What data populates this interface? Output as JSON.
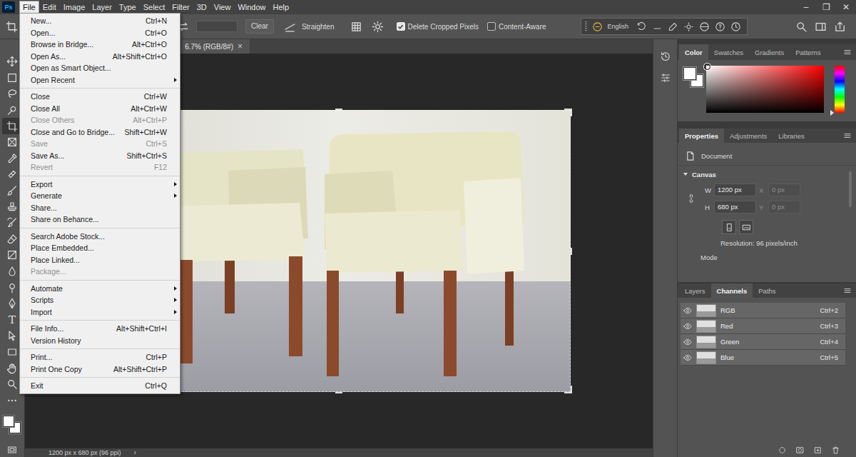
{
  "app": {
    "logo": "Ps",
    "window_controls": [
      "–",
      "❐",
      "✕"
    ]
  },
  "menubar": [
    {
      "label": "File",
      "selected": true
    },
    {
      "label": "Edit",
      "selected": false
    },
    {
      "label": "Image",
      "selected": false
    },
    {
      "label": "Layer",
      "selected": false
    },
    {
      "label": "Type",
      "selected": false
    },
    {
      "label": "Select",
      "selected": false
    },
    {
      "label": "Filter",
      "selected": false
    },
    {
      "label": "3D",
      "selected": false
    },
    {
      "label": "View",
      "selected": false
    },
    {
      "label": "Window",
      "selected": false
    },
    {
      "label": "Help",
      "selected": false
    }
  ],
  "file_menu": [
    [
      {
        "label": "New...",
        "shortcut": "Ctrl+N",
        "disabled": false,
        "submenu": false
      },
      {
        "label": "Open...",
        "shortcut": "Ctrl+O",
        "disabled": false,
        "submenu": false
      },
      {
        "label": "Browse in Bridge...",
        "shortcut": "Alt+Ctrl+O",
        "disabled": false,
        "submenu": false
      },
      {
        "label": "Open As...",
        "shortcut": "Alt+Shift+Ctrl+O",
        "disabled": false,
        "submenu": false
      },
      {
        "label": "Open as Smart Object...",
        "disabled": false,
        "submenu": false
      },
      {
        "label": "Open Recent",
        "disabled": false,
        "submenu": true
      }
    ],
    [
      {
        "label": "Close",
        "shortcut": "Ctrl+W",
        "disabled": false,
        "submenu": false
      },
      {
        "label": "Close All",
        "shortcut": "Alt+Ctrl+W",
        "disabled": false,
        "submenu": false
      },
      {
        "label": "Close Others",
        "shortcut": "Alt+Ctrl+P",
        "disabled": true,
        "submenu": false
      },
      {
        "label": "Close and Go to Bridge...",
        "shortcut": "Shift+Ctrl+W",
        "disabled": false,
        "submenu": false
      },
      {
        "label": "Save",
        "shortcut": "Ctrl+S",
        "disabled": true,
        "submenu": false
      },
      {
        "label": "Save As...",
        "shortcut": "Shift+Ctrl+S",
        "disabled": false,
        "submenu": false
      },
      {
        "label": "Revert",
        "shortcut": "F12",
        "disabled": true,
        "submenu": false
      }
    ],
    [
      {
        "label": "Export",
        "disabled": false,
        "submenu": true
      },
      {
        "label": "Generate",
        "disabled": false,
        "submenu": true
      },
      {
        "label": "Share...",
        "disabled": false,
        "submenu": false
      },
      {
        "label": "Share on Behance...",
        "disabled": false,
        "submenu": false
      }
    ],
    [
      {
        "label": "Search Adobe Stock...",
        "disabled": false,
        "submenu": false
      },
      {
        "label": "Place Embedded...",
        "disabled": false,
        "submenu": false
      },
      {
        "label": "Place Linked...",
        "disabled": false,
        "submenu": false
      },
      {
        "label": "Package...",
        "disabled": true,
        "submenu": false
      }
    ],
    [
      {
        "label": "Automate",
        "disabled": false,
        "submenu": true
      },
      {
        "label": "Scripts",
        "disabled": false,
        "submenu": true
      },
      {
        "label": "Import",
        "disabled": false,
        "submenu": true
      }
    ],
    [
      {
        "label": "File Info...",
        "shortcut": "Alt+Shift+Ctrl+I",
        "disabled": false,
        "submenu": false
      },
      {
        "label": "Version History",
        "disabled": false,
        "submenu": false
      }
    ],
    [
      {
        "label": "Print...",
        "shortcut": "Ctrl+P",
        "disabled": false,
        "submenu": false
      },
      {
        "label": "Print One Copy",
        "shortcut": "Alt+Shift+Ctrl+P",
        "disabled": false,
        "submenu": false
      }
    ],
    [
      {
        "label": "Exit",
        "shortcut": "Ctrl+Q",
        "disabled": false,
        "submenu": false
      }
    ]
  ],
  "options_bar": {
    "clear_button": "Clear",
    "straighten": "Straighten",
    "checkboxes": [
      {
        "label": "Delete Cropped Pixels",
        "checked": true
      },
      {
        "label": "Content-Aware",
        "checked": false
      }
    ]
  },
  "language_bar": {
    "label": "English"
  },
  "document_tab": {
    "title": "6.7% (RGB/8#)",
    "close": "×",
    "selected": true
  },
  "tools": [
    {
      "kind": "move",
      "selected": false
    },
    {
      "kind": "marquee",
      "selected": false
    },
    {
      "kind": "lasso",
      "selected": false
    },
    {
      "kind": "quick-select",
      "selected": false
    },
    {
      "kind": "crop",
      "selected": true
    },
    {
      "kind": "frame",
      "selected": false
    },
    {
      "kind": "eyedropper",
      "selected": false
    },
    {
      "kind": "healing",
      "selected": false
    },
    {
      "kind": "brush",
      "selected": false
    },
    {
      "kind": "stamp",
      "selected": false
    },
    {
      "kind": "history-brush",
      "selected": false
    },
    {
      "kind": "eraser",
      "selected": false
    },
    {
      "kind": "gradient",
      "selected": false
    },
    {
      "kind": "blur",
      "selected": false
    },
    {
      "kind": "dodge",
      "selected": false
    },
    {
      "kind": "pen",
      "selected": false
    },
    {
      "kind": "type",
      "glyph": "T",
      "selected": false
    },
    {
      "kind": "path-select",
      "selected": false
    },
    {
      "kind": "rectangle",
      "selected": false
    },
    {
      "kind": "hand",
      "selected": false
    },
    {
      "kind": "zoom",
      "selected": false
    },
    {
      "kind": "more",
      "selected": false
    }
  ],
  "swatches": {
    "foreground": "#ffffff",
    "background": "#ffffff"
  },
  "status_bar": {
    "info": "1200 px x 680 px (96 ppi)",
    "arrow": "›"
  },
  "color_panel": {
    "tabs": [
      {
        "label": "Color",
        "selected": true
      },
      {
        "label": "Swatches",
        "selected": false
      },
      {
        "label": "Gradients",
        "selected": false
      },
      {
        "label": "Patterns",
        "selected": false
      }
    ],
    "hue_level": 0,
    "saturation": 0,
    "brightness": 1
  },
  "properties_panel": {
    "tabs": [
      {
        "label": "Properties",
        "selected": true
      },
      {
        "label": "Adjustments",
        "selected": false
      },
      {
        "label": "Libraries",
        "selected": false
      }
    ],
    "document_label": "Document",
    "section": {
      "title": "Canvas",
      "expanded": true
    },
    "fields": [
      {
        "label": "W",
        "value": "1200 px",
        "disabled": false
      },
      {
        "label": "X",
        "value": "0 px",
        "disabled": true
      },
      {
        "label": "H",
        "value": "680 px",
        "disabled": false
      },
      {
        "label": "Y",
        "value": "0 px",
        "disabled": true
      }
    ],
    "resolution": "Resolution: 96 pixels/inch",
    "mode_label": "Mode"
  },
  "layers_panel": {
    "tabs": [
      {
        "label": "Layers",
        "selected": false
      },
      {
        "label": "Channels",
        "selected": true
      },
      {
        "label": "Paths",
        "selected": false
      }
    ],
    "channels": [
      {
        "name": "RGB",
        "shortcut": "Ctrl+2",
        "visible": true,
        "selected": true
      },
      {
        "name": "Red",
        "shortcut": "Ctrl+3",
        "visible": true,
        "selected": true
      },
      {
        "name": "Green",
        "shortcut": "Ctrl+4",
        "visible": true,
        "selected": true
      },
      {
        "name": "Blue",
        "shortcut": "Ctrl+5",
        "visible": true,
        "selected": true
      }
    ]
  }
}
